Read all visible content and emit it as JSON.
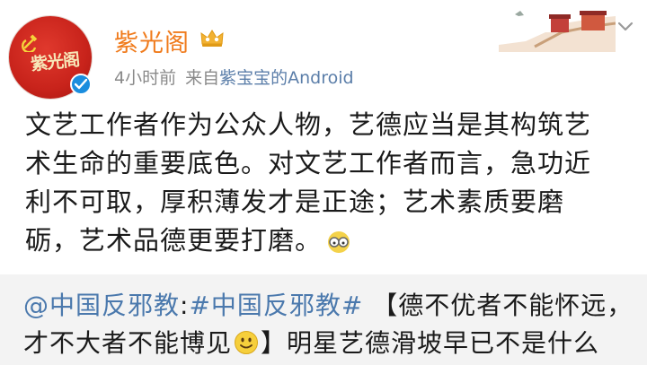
{
  "header": {
    "avatar_text": "紫光阁",
    "username": "紫光阁",
    "time": "4小时前",
    "source_prefix": "来自",
    "source_name": "紫宝宝的Android"
  },
  "post": {
    "lines": [
      "文艺工作者作为公众人物，艺德应当是其构筑艺",
      "术生命的重要底色。对文艺工作者而言，急功近",
      "利不可取，厚积薄发才是正途；艺术素质要磨",
      "砺，艺术品德更要打磨。"
    ]
  },
  "repost": {
    "mention": "@中国反邪教",
    "colon": ":",
    "hashtag": "#中国反邪教#",
    "line1_rest": " 【德不优者不能怀远，",
    "line2_a": "才不大者不能博见",
    "line2_b": "】明星艺德滑坡早已不是什么"
  },
  "colors": {
    "username": "#f07b1c",
    "link": "#4b79ad",
    "avatar_red": "#c8231b",
    "verified_blue": "#1a8dde",
    "repost_bg": "#f3f3f3"
  },
  "icons": [
    "hammer-sickle-icon",
    "verified-badge-icon",
    "crown-vip-icon",
    "great-wall-decoration",
    "chevron-down-icon",
    "glasses-emoji-icon",
    "smile-emoji-icon"
  ]
}
